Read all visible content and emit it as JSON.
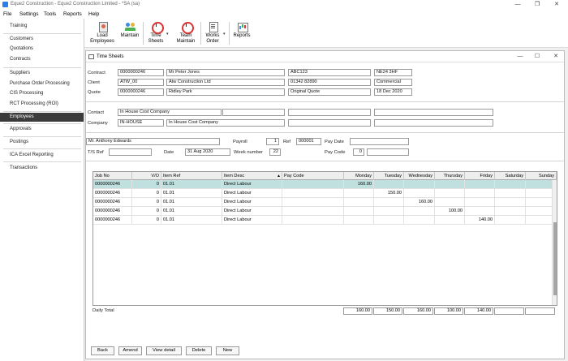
{
  "window": {
    "title": "Eque2 Construction - Eque2 Construction Limited - *SA (sa)",
    "min": "—",
    "max": "❐",
    "close": "✕"
  },
  "menu": [
    "File",
    "Settings",
    "Tools",
    "Reports",
    "Help"
  ],
  "sidebar": {
    "items": [
      "Training",
      "Customers",
      "Quotations",
      "Contracts",
      "Suppliers",
      "Purchase Order Processing",
      "CIS Processing",
      "RCT Processing (ROI)",
      "Employees",
      "Approvals",
      "Postings",
      "ICA Excel Reporting",
      "Transactions"
    ],
    "active": "Employees"
  },
  "toolbar": {
    "load_l1": "Load",
    "load_l2": "Employees",
    "maintain": "Maintain",
    "time_l1": "Time",
    "time_l2": "Sheets",
    "team_l1": "Team",
    "team_l2": "Maintain",
    "works_l1": "Works",
    "works_l2": "Order",
    "reports": "Reports",
    "caret": "▾"
  },
  "child": {
    "title": "Time Sheets",
    "min": "—",
    "max": "☐",
    "close": "✕"
  },
  "header": {
    "contract_label": "Contract",
    "contract_code": "0000000246",
    "contract_name": "Mr Peter Jones",
    "contract_ref": "ABC123",
    "contract_postcode": "NE24 3HF",
    "client_label": "Client",
    "client_code": "ATW_00",
    "client_name": "Atw Construction Ltd",
    "client_phone": "01342 82890",
    "client_type": "Commercial",
    "quote_label": "Quote",
    "quote_code": "0000000246",
    "quote_name": "Ridley Park",
    "quote_desc": "Original Quote",
    "quote_date": "18 Dec 2020",
    "contact_label": "Contact",
    "contact_value": "In House Cost Company",
    "company_label": "Company",
    "company_code": "IN-HOUSE",
    "company_name": "In House Cost Company"
  },
  "employee": {
    "name": "Mr. Anthony Edwards",
    "payroll_label": "Payroll",
    "payroll_value": "1",
    "ref_label": "Ref",
    "ref_value": "000001",
    "paydate_label": "Pay Date",
    "paydate_value": "",
    "tsref_label": "T/S Ref",
    "tsref_value": "",
    "date_label": "Date",
    "date_value": "31 Aug 2020",
    "week_label": "Week number",
    "week_value": "22",
    "paycode_label": "Pay Code",
    "paycode_value": "0",
    "paycode_desc": ""
  },
  "grid": {
    "columns": [
      "Job No",
      "V/O",
      "Item Ref",
      "Item Desc",
      "Pay Code",
      "Monday",
      "Tuesday",
      "Wednesday",
      "Thursday",
      "Friday",
      "Saturday",
      "Sunday"
    ],
    "sort_indicator": "▲",
    "rows": [
      {
        "job": "0000000246",
        "vo": "0",
        "item_ref": "01.01",
        "desc": "Direct Labour",
        "pay": "",
        "mon": "160.00",
        "tue": "",
        "wed": "",
        "thu": "",
        "fri": "",
        "sat": "",
        "sun": ""
      },
      {
        "job": "0000000246",
        "vo": "0",
        "item_ref": "01.01",
        "desc": "Direct Labour",
        "pay": "",
        "mon": "",
        "tue": "150.00",
        "wed": "",
        "thu": "",
        "fri": "",
        "sat": "",
        "sun": ""
      },
      {
        "job": "0000000246",
        "vo": "0",
        "item_ref": "01.01",
        "desc": "Direct Labour",
        "pay": "",
        "mon": "",
        "tue": "",
        "wed": "160.00",
        "thu": "",
        "fri": "",
        "sat": "",
        "sun": ""
      },
      {
        "job": "0000000246",
        "vo": "0",
        "item_ref": "01.01",
        "desc": "Direct Labour",
        "pay": "",
        "mon": "",
        "tue": "",
        "wed": "",
        "thu": "100.00",
        "fri": "",
        "sat": "",
        "sun": ""
      },
      {
        "job": "0000000246",
        "vo": "0",
        "item_ref": "01.01",
        "desc": "Direct Labour",
        "pay": "",
        "mon": "",
        "tue": "",
        "wed": "",
        "thu": "",
        "fri": "140.00",
        "sat": "",
        "sun": ""
      }
    ]
  },
  "totals": {
    "label": "Daily Total",
    "mon": "160.00",
    "tue": "150.00",
    "wed": "160.00",
    "thu": "100.00",
    "fri": "140.00",
    "sat": "",
    "sun": ""
  },
  "buttons": {
    "back": "Back",
    "amend": "Amend",
    "view": "View detail",
    "delete": "Delete",
    "new": "New"
  }
}
